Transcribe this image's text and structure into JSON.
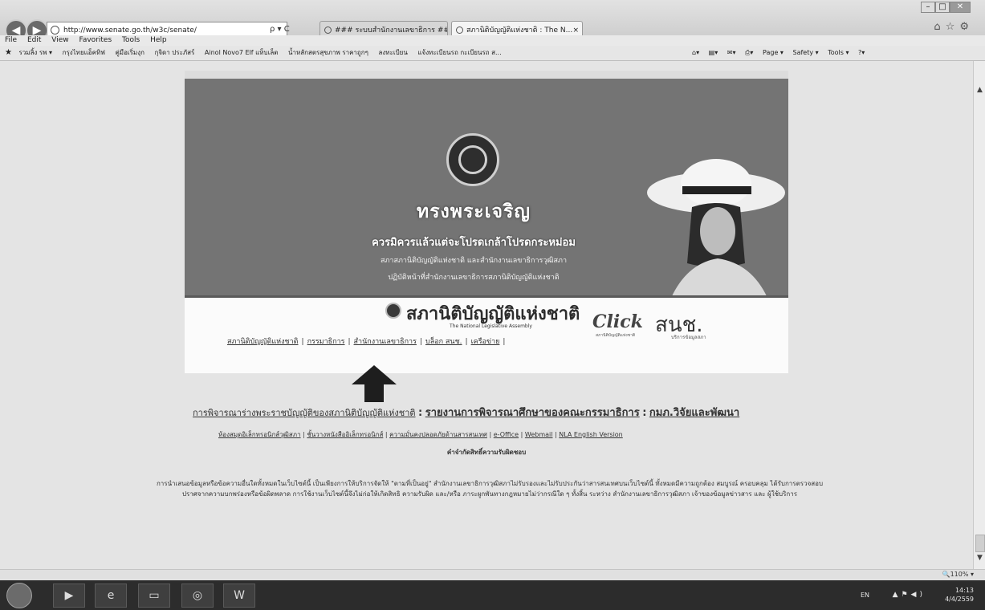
{
  "browser": {
    "address_url": "http://www.senate.go.th/w3c/senate/",
    "address_controls": "ρ ▾ C",
    "tabs": [
      {
        "label": "### ระบบสำนักงานเลขาธิการ ###",
        "active": false
      },
      {
        "label": "สภานิติบัญญัติแห่งชาติ : The N...",
        "active": true
      }
    ],
    "menu": [
      "File",
      "Edit",
      "View",
      "Favorites",
      "Tools",
      "Help"
    ],
    "favorites": [
      "รวมลิ้ง รพ ▾",
      "กรุงไทยแอ็คทิฟ",
      "คู่มือเริ่มงุก",
      "กุจิดา ประภัสร์",
      "Ainol Novo7 Elf แท็บเล็ต",
      "น้ำหลักสตรสุขภาพ ราคาถูกๆ",
      "ลงทะเบียน",
      "แจ้งทะเบียนรถ กะเบียนรถ ส..."
    ],
    "command_bar": [
      "Page ▾",
      "Safety ▾",
      "Tools ▾",
      "?▾"
    ]
  },
  "banner": {
    "headline": "ทรงพระเจริญ",
    "subline": "ควรมิควรแล้วแต่จะโปรดเกล้าโปรดกระหม่อม",
    "line3": "สภาสภานิติบัญญัติแห่งชาติ และสำนักงานเลขาธิการวุฒิสภา",
    "line4": "ปฏิบัติหน้าที่สำนักงานเลขาธิการสภานิติบัญญัติแห่งชาติ"
  },
  "logo": {
    "title": "สภานิติบัญญัติแห่งชาติ",
    "subtitle": "The National Legislative Assembly",
    "click_text": "Click",
    "snc_text": "สนช.",
    "click_sub": "สภานิติบัญญัติแห่งชาติ",
    "snc_small": "บริการข้อมูลสภา"
  },
  "nav_links": [
    "สภานิติบัญญัติแห่งชาติ",
    "กรรมาธิการ",
    "สำนักงานเลขาธิการ",
    "บล็อก สนช.",
    "เครือข่าย"
  ],
  "footer": {
    "link_a": "การพิจารณาร่างพระราชบัญญัติของสภานิติบัญญัติแห่งชาติ",
    "link_b": "รายงานการพิจารณาศึกษาของคณะกรรมาธิการ",
    "link_c": "กมภ.วิจัยและพัฒนา",
    "sep": ":",
    "links2": [
      "ห้องสมุดอิเล็กทรอนิกส์วุฒิสภา",
      "ชั้นวางหนังสืออิเล็กทรอนิกส์",
      "ความมั่นคงปลอดภัยด้านสารสนเทศ",
      "e-Office",
      "Webmail",
      "NLA English Version"
    ],
    "disclaimer_title": "คำจำกัดสิทธิ์ความรับผิดชอบ",
    "disclaimer_text": "การนำเสนอข้อมูลหรือข้อความอื่นใดทั้งหมดในเว็บไซต์นี้ เป็นเพียงการให้บริการจัดให้ \"ตามที่เป็นอยู่\" สำนักงานเลขาธิการวุฒิสภาไม่รับรองและไม่รับประกันว่าสารสนเทศบนเว็บไซต์นี้ ทั้งหมดมีความถูกต้อง สมบูรณ์ ครอบคลุม ได้รับการตรวจสอบ ปราศจากความบกพร่องหรือข้อผิดพลาด การใช้งานเว็บไซต์นี้จึงไม่ก่อให้เกิดสิทธิ ความรับผิด และ/หรือ ภาระผูกพันทางกฎหมายไม่ว่ากรณีใด ๆ ทั้งสิ้น ระหว่าง สำนักงานเลขาธิการวุฒิสภา เจ้าของข้อมูลข่าวสาร และ ผู้ใช้บริการ"
  },
  "status": {
    "zoom": "110%"
  },
  "taskbar": {
    "lang": "EN",
    "time": "14:13",
    "date": "4/4/2559",
    "app_word": "W"
  }
}
